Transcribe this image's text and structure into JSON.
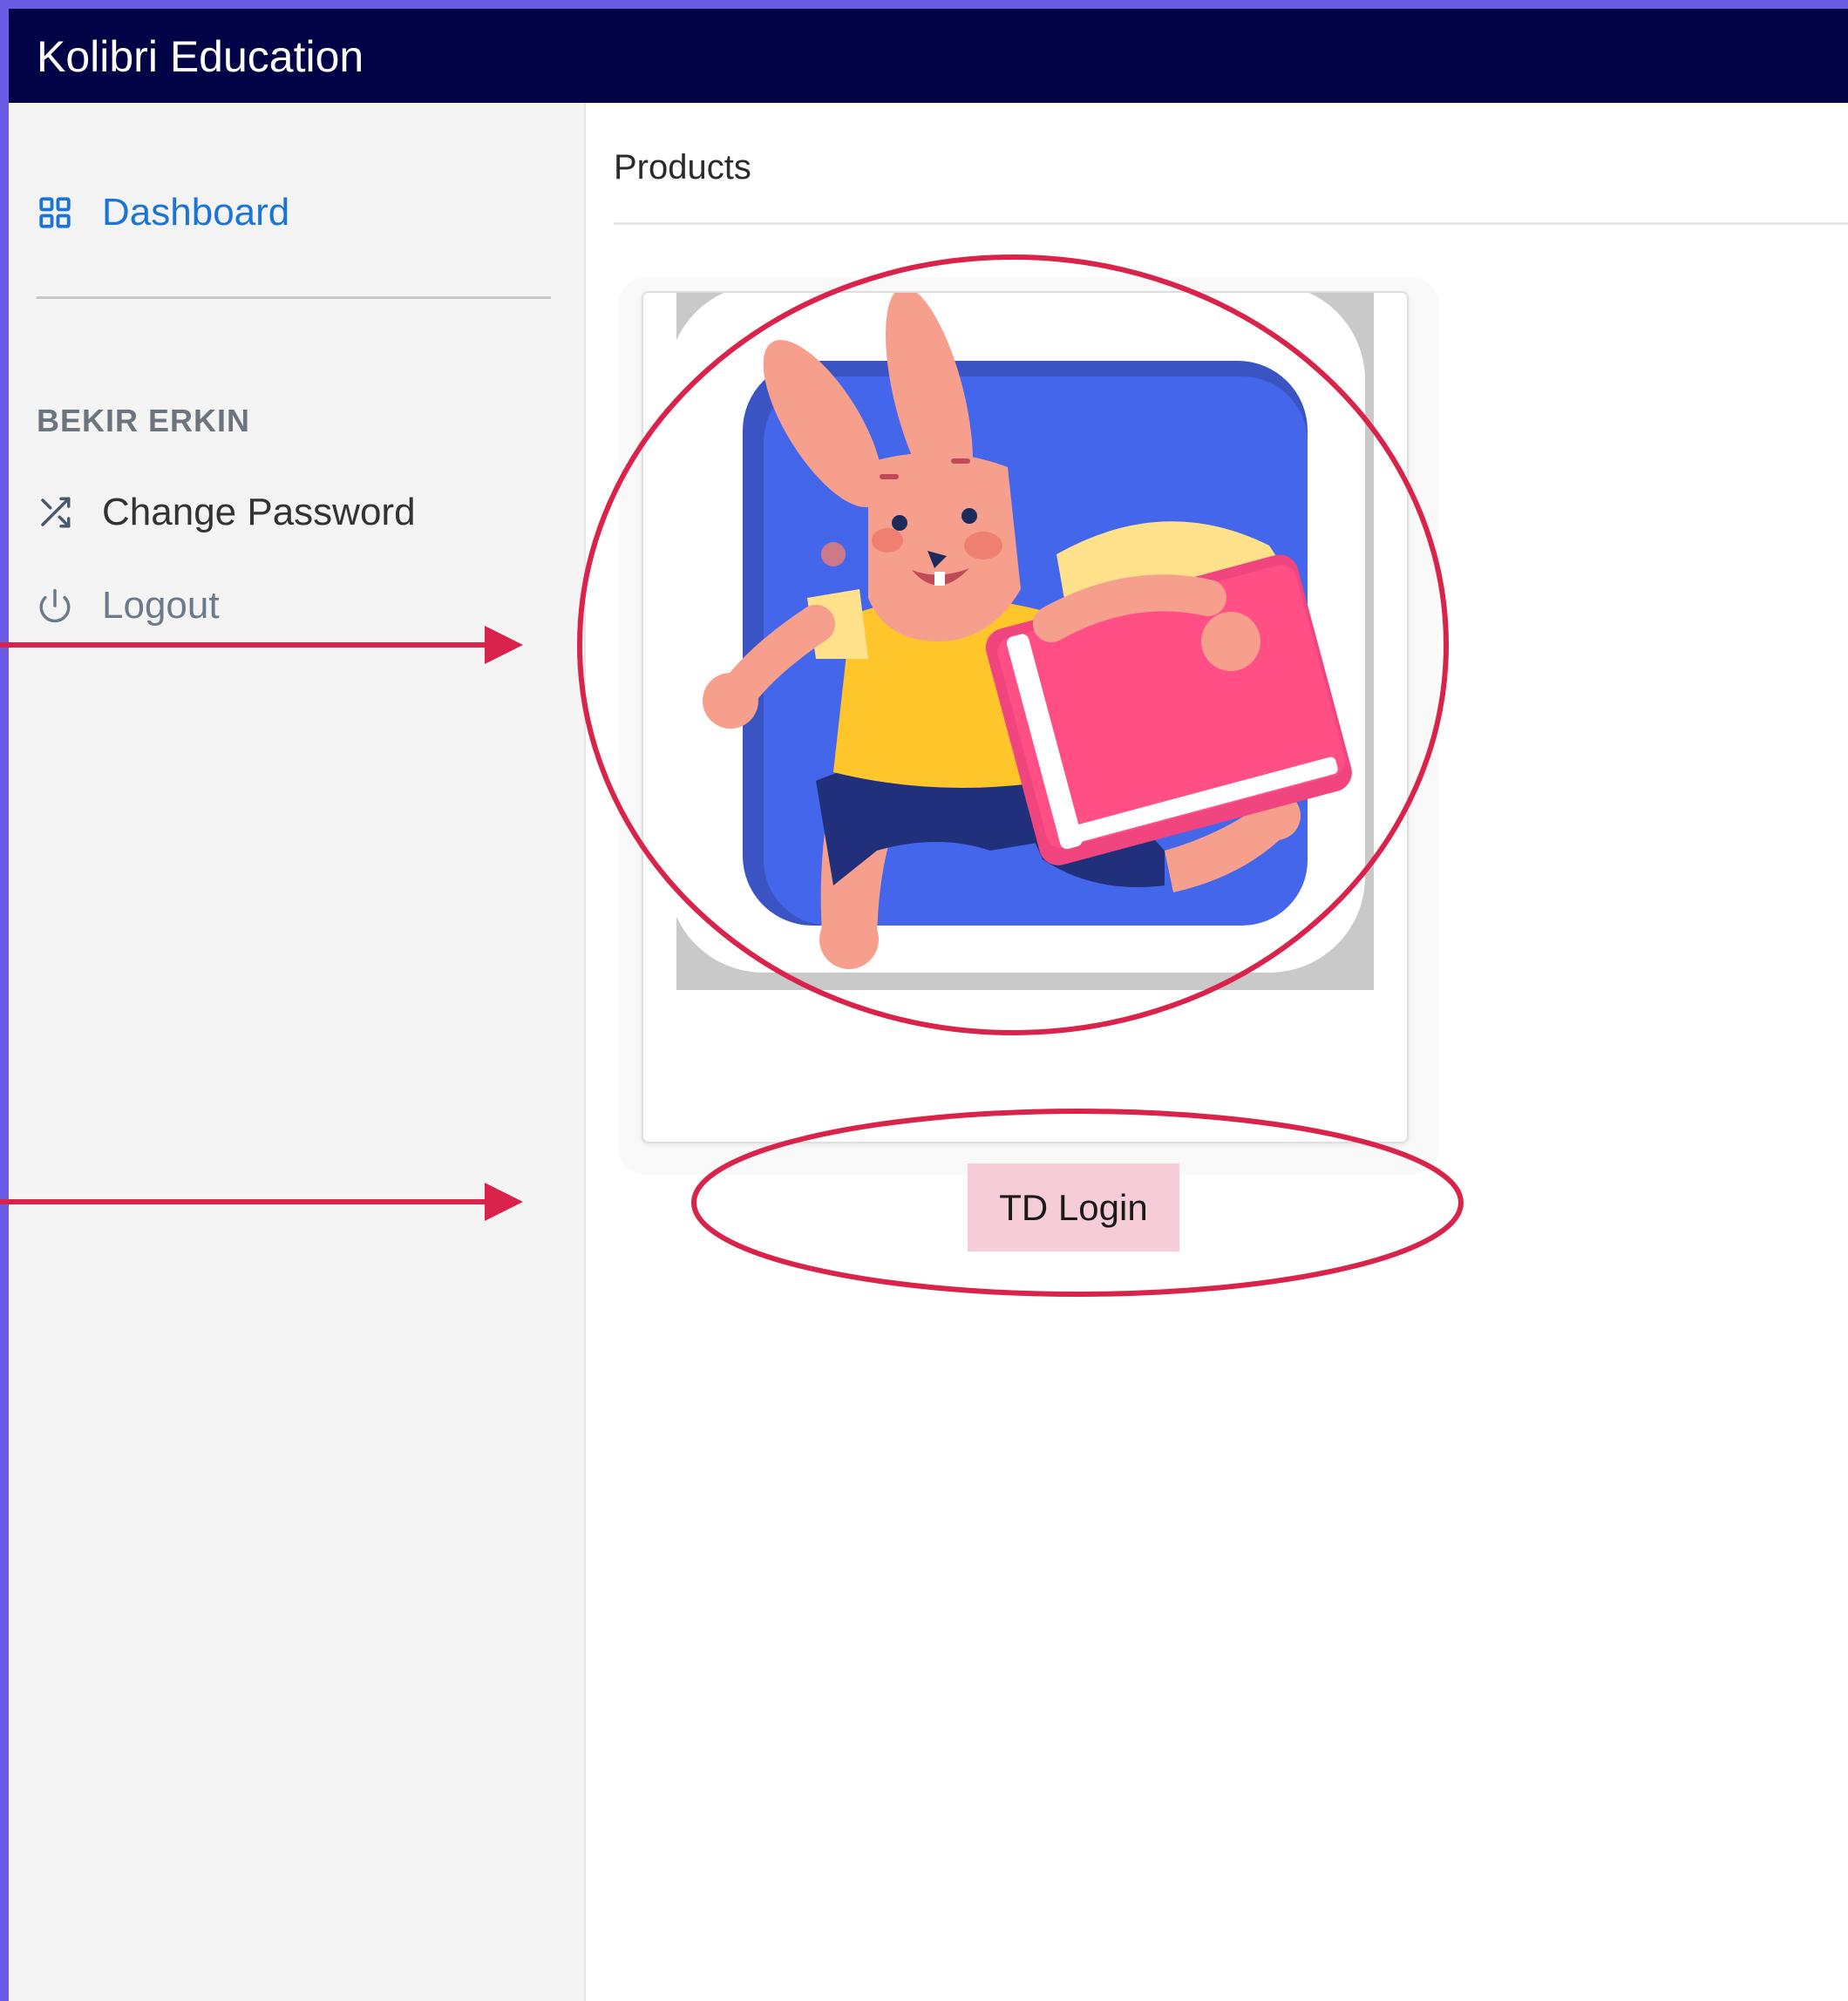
{
  "app": {
    "title": "Kolibri Education"
  },
  "sidebar": {
    "dashboard_label": "Dashboard",
    "user_name": "BEKIR ERKIN",
    "items": [
      {
        "label": "Change Password",
        "icon": "shuffle-icon"
      },
      {
        "label": "Logout",
        "icon": "power-icon"
      }
    ]
  },
  "content": {
    "title": "Products",
    "product": {
      "button_label": "TD Login",
      "image": "bunny-reading-app-icon"
    }
  },
  "colors": {
    "topbar": "#020247",
    "accent_blue": "#1b74d6",
    "button_pink": "#f6ccd9",
    "annotation_red": "#d9234a",
    "frame_border": "#6b5ce6"
  }
}
